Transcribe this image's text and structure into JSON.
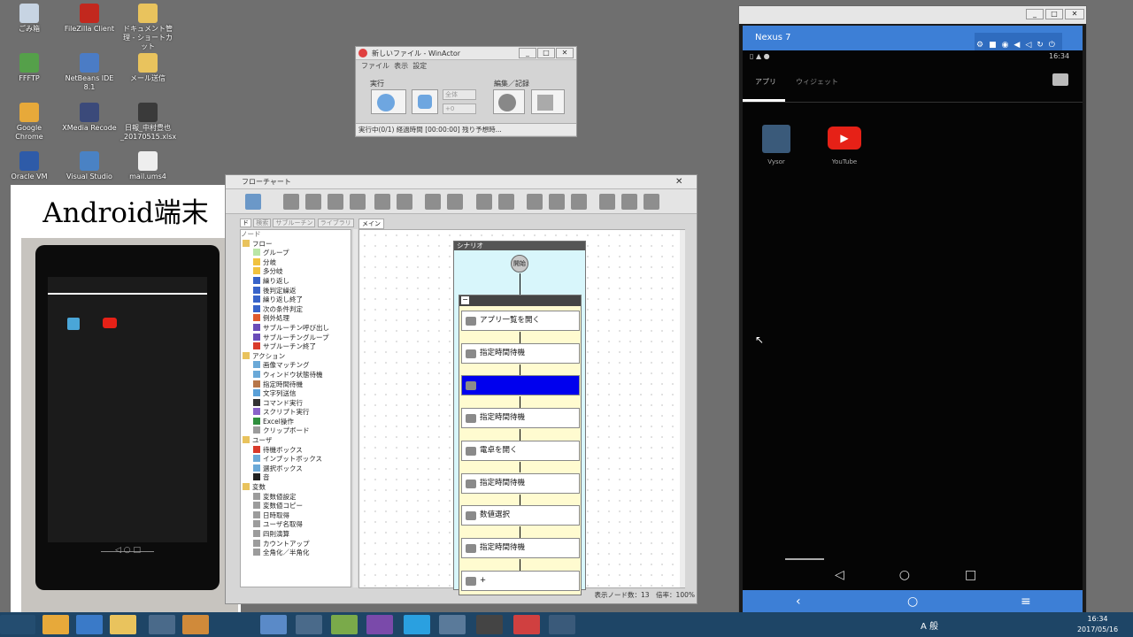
{
  "desktop": {
    "icons": [
      {
        "label": "ごみ箱",
        "icon": "recycle-bin-icon",
        "color": "#c7d4e3"
      },
      {
        "label": "FileZilla Client",
        "icon": "filezilla-icon",
        "color": "#c2281e"
      },
      {
        "label": "ドキュメント管理 - ショートカット",
        "icon": "folder-icon",
        "color": "#e9c35d"
      },
      {
        "label": "FFFTP",
        "icon": "ffftp-icon",
        "color": "#55a04a"
      },
      {
        "label": "NetBeans IDE 8.1",
        "icon": "netbeans-icon",
        "color": "#4b7cc5"
      },
      {
        "label": "メール送信",
        "icon": "folder-icon",
        "color": "#e9c35d"
      },
      {
        "label": "Google Chrome",
        "icon": "chrome-icon",
        "color": "#e7a93a"
      },
      {
        "label": "XMedia Recode",
        "icon": "xmedia-icon",
        "color": "#3b4a7a"
      },
      {
        "label": "日報_中村豊也_20170515.xlsx",
        "icon": "excel-file-icon",
        "color": "#3a3a3a"
      },
      {
        "label": "Oracle VM",
        "icon": "virtualbox-icon",
        "color": "#2e5ba8"
      },
      {
        "label": "Visual Studio",
        "icon": "visual-studio-icon",
        "color": "#4a82c4"
      },
      {
        "label": "mail.ums4",
        "icon": "mail-file-icon",
        "color": "#eeeeee"
      }
    ]
  },
  "photo": {
    "caption": "Android端末"
  },
  "winactor": {
    "title": "新しいファイル - WinActor",
    "menu": [
      "ファイル",
      "表示",
      "設定"
    ],
    "group_run": "実行",
    "group_edit": "編集／記録",
    "scope": "全体",
    "speed": "+0",
    "status": "実行中(0/1) 経過時間 [00:00:00] 残り予想時..."
  },
  "flowchart": {
    "title": "フローチャート",
    "tabs": [
      "ド",
      "検索",
      "サブルーチン",
      "ライブラリ"
    ],
    "main_tab": "メイン",
    "tree_header": "ノード",
    "tree": [
      {
        "label": "フロー",
        "level": 0,
        "color": "#e9c35d"
      },
      {
        "label": "グループ",
        "level": 1,
        "color": "#b9e6a6"
      },
      {
        "label": "分岐",
        "level": 1,
        "color": "#f0c23f"
      },
      {
        "label": "多分岐",
        "level": 1,
        "color": "#f0c23f"
      },
      {
        "label": "繰り返し",
        "level": 1,
        "color": "#3863c9"
      },
      {
        "label": "後判定繰返",
        "level": 1,
        "color": "#3863c9"
      },
      {
        "label": "繰り返し終了",
        "level": 1,
        "color": "#3863c9"
      },
      {
        "label": "次の条件判定",
        "level": 1,
        "color": "#3863c9"
      },
      {
        "label": "例外処理",
        "level": 1,
        "color": "#e05b2d"
      },
      {
        "label": "サブルーチン呼び出し",
        "level": 1,
        "color": "#6a4cb8"
      },
      {
        "label": "サブルーチングループ",
        "level": 1,
        "color": "#6a4cb8"
      },
      {
        "label": "サブルーチン終了",
        "level": 1,
        "color": "#d93a2b"
      },
      {
        "label": "アクション",
        "level": 0,
        "color": "#e9c35d"
      },
      {
        "label": "画像マッチング",
        "level": 1,
        "color": "#6aa9d8"
      },
      {
        "label": "ウィンドウ状態待機",
        "level": 1,
        "color": "#6aa9d8"
      },
      {
        "label": "指定時間待機",
        "level": 1,
        "color": "#b6764a"
      },
      {
        "label": "文字列送信",
        "level": 1,
        "color": "#5aa0d8"
      },
      {
        "label": "コマンド実行",
        "level": 1,
        "color": "#333333"
      },
      {
        "label": "スクリプト実行",
        "level": 1,
        "color": "#8a63c9"
      },
      {
        "label": "Excel操作",
        "level": 1,
        "color": "#2f8f3e"
      },
      {
        "label": "クリップボード",
        "level": 1,
        "color": "#9c9c9c"
      },
      {
        "label": "ユーザ",
        "level": 0,
        "color": "#e9c35d"
      },
      {
        "label": "待機ボックス",
        "level": 1,
        "color": "#d93a2b"
      },
      {
        "label": "インプットボックス",
        "level": 1,
        "color": "#6aa9d8"
      },
      {
        "label": "選択ボックス",
        "level": 1,
        "color": "#6aa9d8"
      },
      {
        "label": "音",
        "level": 1,
        "color": "#222222"
      },
      {
        "label": "変数",
        "level": 0,
        "color": "#e9c35d"
      },
      {
        "label": "変数値設定",
        "level": 1,
        "color": "#9c9c9c"
      },
      {
        "label": "変数値コピー",
        "level": 1,
        "color": "#9c9c9c"
      },
      {
        "label": "日時取得",
        "level": 1,
        "color": "#9c9c9c"
      },
      {
        "label": "ユーザ名取得",
        "level": 1,
        "color": "#9c9c9c"
      },
      {
        "label": "四則演算",
        "level": 1,
        "color": "#9c9c9c"
      },
      {
        "label": "カウントアップ",
        "level": 1,
        "color": "#9c9c9c"
      },
      {
        "label": "全角化／半角化",
        "level": 1,
        "color": "#9c9c9c"
      }
    ],
    "scenario_label": "シナリオ",
    "start_label": "開始",
    "group_toggle": "−",
    "nodes": [
      {
        "label": "アプリ一覧を開く",
        "selected": false
      },
      {
        "label": "指定時間待機",
        "selected": false
      },
      {
        "label": "",
        "selected": true
      },
      {
        "label": "指定時間待機",
        "selected": false
      },
      {
        "label": "電卓を開く",
        "selected": false
      },
      {
        "label": "指定時間待機",
        "selected": false
      },
      {
        "label": "数値選択",
        "selected": false
      },
      {
        "label": "指定時間待機",
        "selected": false
      },
      {
        "label": "+",
        "selected": false
      }
    ],
    "status": "表示ノード数：13　倍率：100%"
  },
  "nexus": {
    "title": "Nexus 7",
    "time": "16:34",
    "tabs": [
      "アプリ",
      "ウィジェット"
    ],
    "apps": [
      {
        "label": "Vysor",
        "icon": "vysor-icon",
        "color": "#3a5a7a"
      },
      {
        "label": "YouTube",
        "icon": "youtube-icon",
        "color": "#e62117"
      }
    ]
  },
  "taskbar": {
    "ime": "A 般",
    "time": "16:34",
    "date": "2017/05/16"
  }
}
